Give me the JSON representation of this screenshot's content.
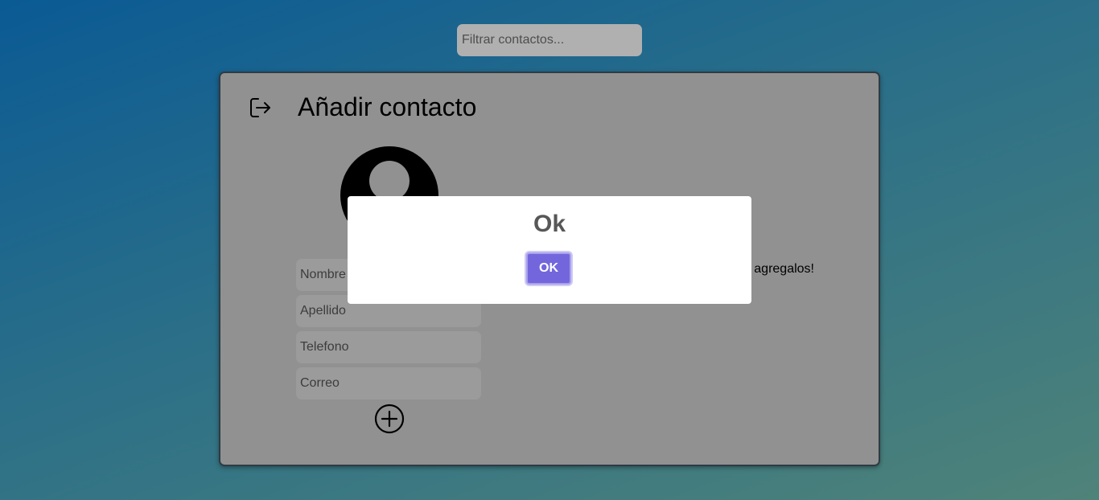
{
  "search": {
    "placeholder": "Filtrar contactos..."
  },
  "card": {
    "title": "Añadir contacto",
    "empty_message": "agregalos!",
    "fields": {
      "nombre": "Nombre",
      "apellido": "Apellido",
      "telefono": "Telefono",
      "correo": "Correo"
    },
    "icons": {
      "logout": "logout-icon",
      "avatar": "user-avatar-icon",
      "add": "plus-circle-icon"
    }
  },
  "dialog": {
    "title": "Ok",
    "confirm_label": "OK"
  },
  "colors": {
    "accent": "#7366dd",
    "card_bg": "#919191",
    "field_bg": "#9b9b9b"
  }
}
